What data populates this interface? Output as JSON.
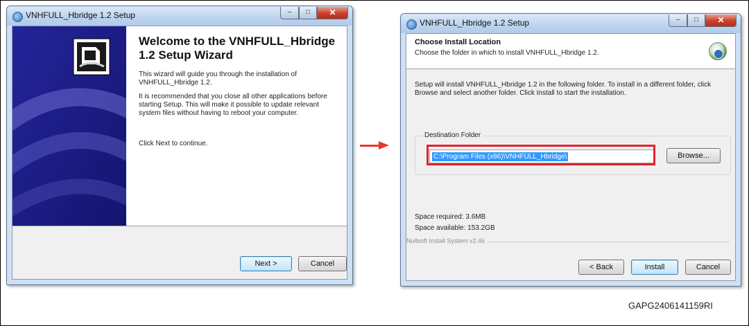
{
  "setup1": {
    "title": "VNHFULL_Hbridge 1.2 Setup",
    "heading": "Welcome to the VNHFULL_Hbridge 1.2 Setup Wizard",
    "para1": "This wizard will guide you through the installation of VNHFULL_Hbridge 1.2.",
    "para2": "It is recommended that you close all other applications before starting Setup. This will make it possible to update relevant system files without having to reboot your computer.",
    "para3": "Click Next to continue.",
    "next_label": "Next >",
    "cancel_label": "Cancel"
  },
  "setup2": {
    "title": "VNHFULL_Hbridge 1.2 Setup",
    "header_title": "Choose Install Location",
    "header_subtitle": "Choose the folder in which to install VNHFULL_Hbridge 1.2.",
    "info": "Setup will install VNHFULL_Hbridge 1.2 in the following folder. To install in a different folder, click Browse and select another folder. Click Install to start the installation.",
    "destination_label": "Destination Folder",
    "destination_path": "C:\\Program Files (x86)\\VNHFULL_Hbridge\\",
    "browse_label": "Browse...",
    "space_required": "Space required: 3.6MB",
    "space_available": "Space available: 153.2GB",
    "branding": "Nullsoft Install System v2.46",
    "back_label": "< Back",
    "install_label": "Install",
    "cancel_label": "Cancel"
  },
  "figure_code": "GAPG2406141159RI",
  "colors": {
    "highlight_box": "#e22230",
    "arrow": "#e8382a",
    "sidebar": "#1f1f8c",
    "selection": "#3399ff"
  }
}
